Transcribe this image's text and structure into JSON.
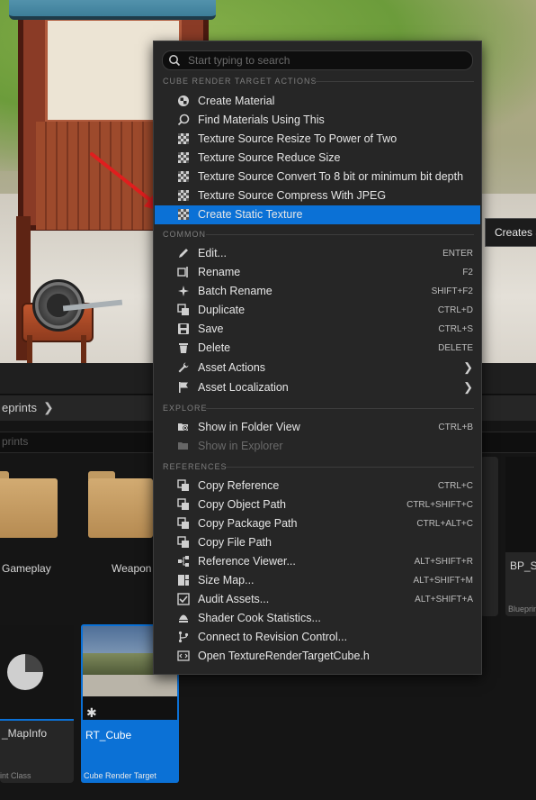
{
  "menu": {
    "search_placeholder": "Start typing to search",
    "sections": {
      "cube_actions": "CUBE RENDER TARGET ACTIONS",
      "common": "COMMON",
      "explore": "EXPLORE",
      "references": "REFERENCES"
    },
    "cube_items": [
      {
        "label": "Create Material",
        "icon": "material-icon"
      },
      {
        "label": "Find Materials Using This",
        "icon": "search-material-icon"
      },
      {
        "label": "Texture Source Resize To Power of Two",
        "icon": "texture-icon"
      },
      {
        "label": "Texture Source Reduce Size",
        "icon": "texture-icon"
      },
      {
        "label": "Texture Source Convert To 8 bit or minimum bit depth",
        "icon": "texture-icon"
      },
      {
        "label": "Texture Source Compress With JPEG",
        "icon": "texture-icon"
      },
      {
        "label": "Create Static Texture",
        "icon": "texture-icon",
        "highlighted": true
      }
    ],
    "common_items": [
      {
        "label": "Edit...",
        "shortcut": "ENTER",
        "icon": "pencil-icon"
      },
      {
        "label": "Rename",
        "shortcut": "F2",
        "icon": "rename-icon"
      },
      {
        "label": "Batch Rename",
        "shortcut": "SHIFT+F2",
        "icon": "sparkle-icon"
      },
      {
        "label": "Duplicate",
        "shortcut": "CTRL+D",
        "icon": "duplicate-icon"
      },
      {
        "label": "Save",
        "shortcut": "CTRL+S",
        "icon": "save-icon"
      },
      {
        "label": "Delete",
        "shortcut": "DELETE",
        "icon": "trash-icon"
      },
      {
        "label": "Asset Actions",
        "submenu": true,
        "icon": "wrench-icon"
      },
      {
        "label": "Asset Localization",
        "submenu": true,
        "icon": "flag-icon"
      }
    ],
    "explore_items": [
      {
        "label": "Show in Folder View",
        "shortcut": "CTRL+B",
        "icon": "folder-search-icon"
      },
      {
        "label": "Show in Explorer",
        "disabled": true,
        "icon": "folder-icon"
      }
    ],
    "reference_items": [
      {
        "label": "Copy Reference",
        "shortcut": "CTRL+C",
        "icon": "copy-icon"
      },
      {
        "label": "Copy Object Path",
        "shortcut": "CTRL+SHIFT+C",
        "icon": "copy-icon"
      },
      {
        "label": "Copy Package Path",
        "shortcut": "CTRL+ALT+C",
        "icon": "copy-icon"
      },
      {
        "label": "Copy File Path",
        "icon": "copy-icon"
      },
      {
        "label": "Reference Viewer...",
        "shortcut": "ALT+SHIFT+R",
        "icon": "reference-viewer-icon"
      },
      {
        "label": "Size Map...",
        "shortcut": "ALT+SHIFT+M",
        "icon": "size-map-icon"
      },
      {
        "label": "Audit Assets...",
        "shortcut": "ALT+SHIFT+A",
        "icon": "audit-icon"
      },
      {
        "label": "Shader Cook Statistics...",
        "icon": "shader-icon"
      },
      {
        "label": "Connect to Revision Control...",
        "icon": "branch-icon"
      },
      {
        "label": "Open TextureRenderTargetCube.h",
        "icon": "code-file-icon"
      }
    ]
  },
  "tooltip": {
    "text": "Creates a"
  },
  "content_browser": {
    "breadcrumb": "eprints",
    "search_text": "prints",
    "tiles": [
      {
        "label": "Gameplay",
        "type": "folder"
      },
      {
        "label": "Weapon",
        "type": "folder"
      },
      {
        "label": "BP_S",
        "sublabel": "Blueprin"
      },
      {
        "label": "_MapInfo",
        "sublabel": "int Class"
      },
      {
        "label": "RT_Cube",
        "sublabel": "Cube Render Target",
        "selected": true
      }
    ]
  },
  "colors": {
    "highlight": "#0b71d6",
    "menu_bg": "#262626",
    "arrow": "#e01e1e"
  }
}
